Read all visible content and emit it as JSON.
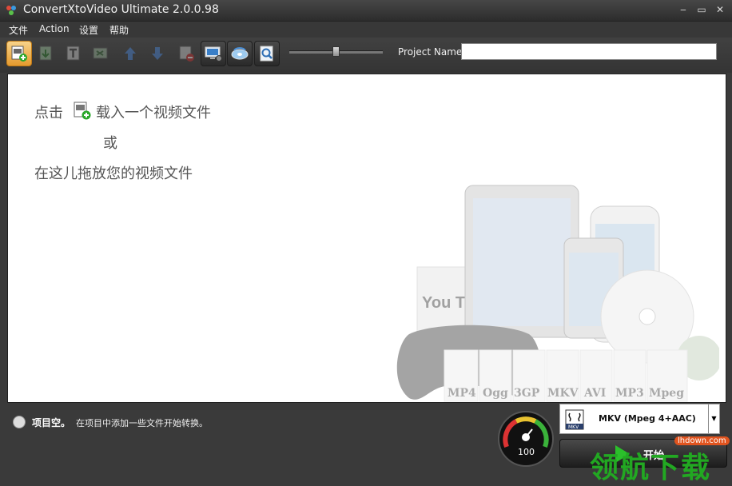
{
  "window": {
    "title": "ConvertXtoVideo Ultimate 2.0.0.98",
    "controls": {
      "minimize": "‒",
      "maximize": "▭",
      "close": "✕"
    }
  },
  "menu": {
    "items": [
      "文件",
      "Action",
      "设置",
      "帮助"
    ]
  },
  "toolbar": {
    "buttons": [
      {
        "icon": "add-video-icon",
        "state": "active"
      },
      {
        "icon": "video-export-icon",
        "state": "disabled"
      },
      {
        "icon": "text-title-icon",
        "state": "disabled"
      },
      {
        "icon": "video-edit-icon",
        "state": "disabled"
      },
      {
        "icon": "arrow-up-icon",
        "state": "disabled"
      },
      {
        "icon": "arrow-down-icon",
        "state": "disabled"
      },
      {
        "icon": "remove-video-icon",
        "state": "disabled"
      },
      {
        "icon": "display-settings-icon",
        "state": "normal"
      },
      {
        "icon": "disc-burn-icon",
        "state": "normal"
      },
      {
        "icon": "preview-search-icon",
        "state": "normal"
      }
    ],
    "zoom_slider": 0.5,
    "project_name_label": "Project Name",
    "project_name_value": ""
  },
  "main": {
    "hint_click_prefix": "点击",
    "hint_click_suffix": "载入一个视频文件",
    "hint_or": "或",
    "hint_drag": "在这儿拖放您的视频文件",
    "format_tiles": [
      "MP4",
      "Ogg",
      "3GP",
      "MKV",
      "AVI",
      "MP3",
      "Mpeg"
    ],
    "youtube_text": "You Tube"
  },
  "status": {
    "title": "项目空。",
    "message": "在项目中添加一些文件开始转换。"
  },
  "gauge": {
    "value": "100"
  },
  "format_selector": {
    "icon_label": "MKV",
    "selected": "MKV (Mpeg 4+AAC)"
  },
  "start_button": {
    "label": "开始"
  },
  "watermark": {
    "text": "领航下载",
    "site": "lhdown.com"
  },
  "colors": {
    "active_button": "#e59a2e",
    "start_arrow": "#2bbf2b",
    "watermark": "#22a822"
  }
}
